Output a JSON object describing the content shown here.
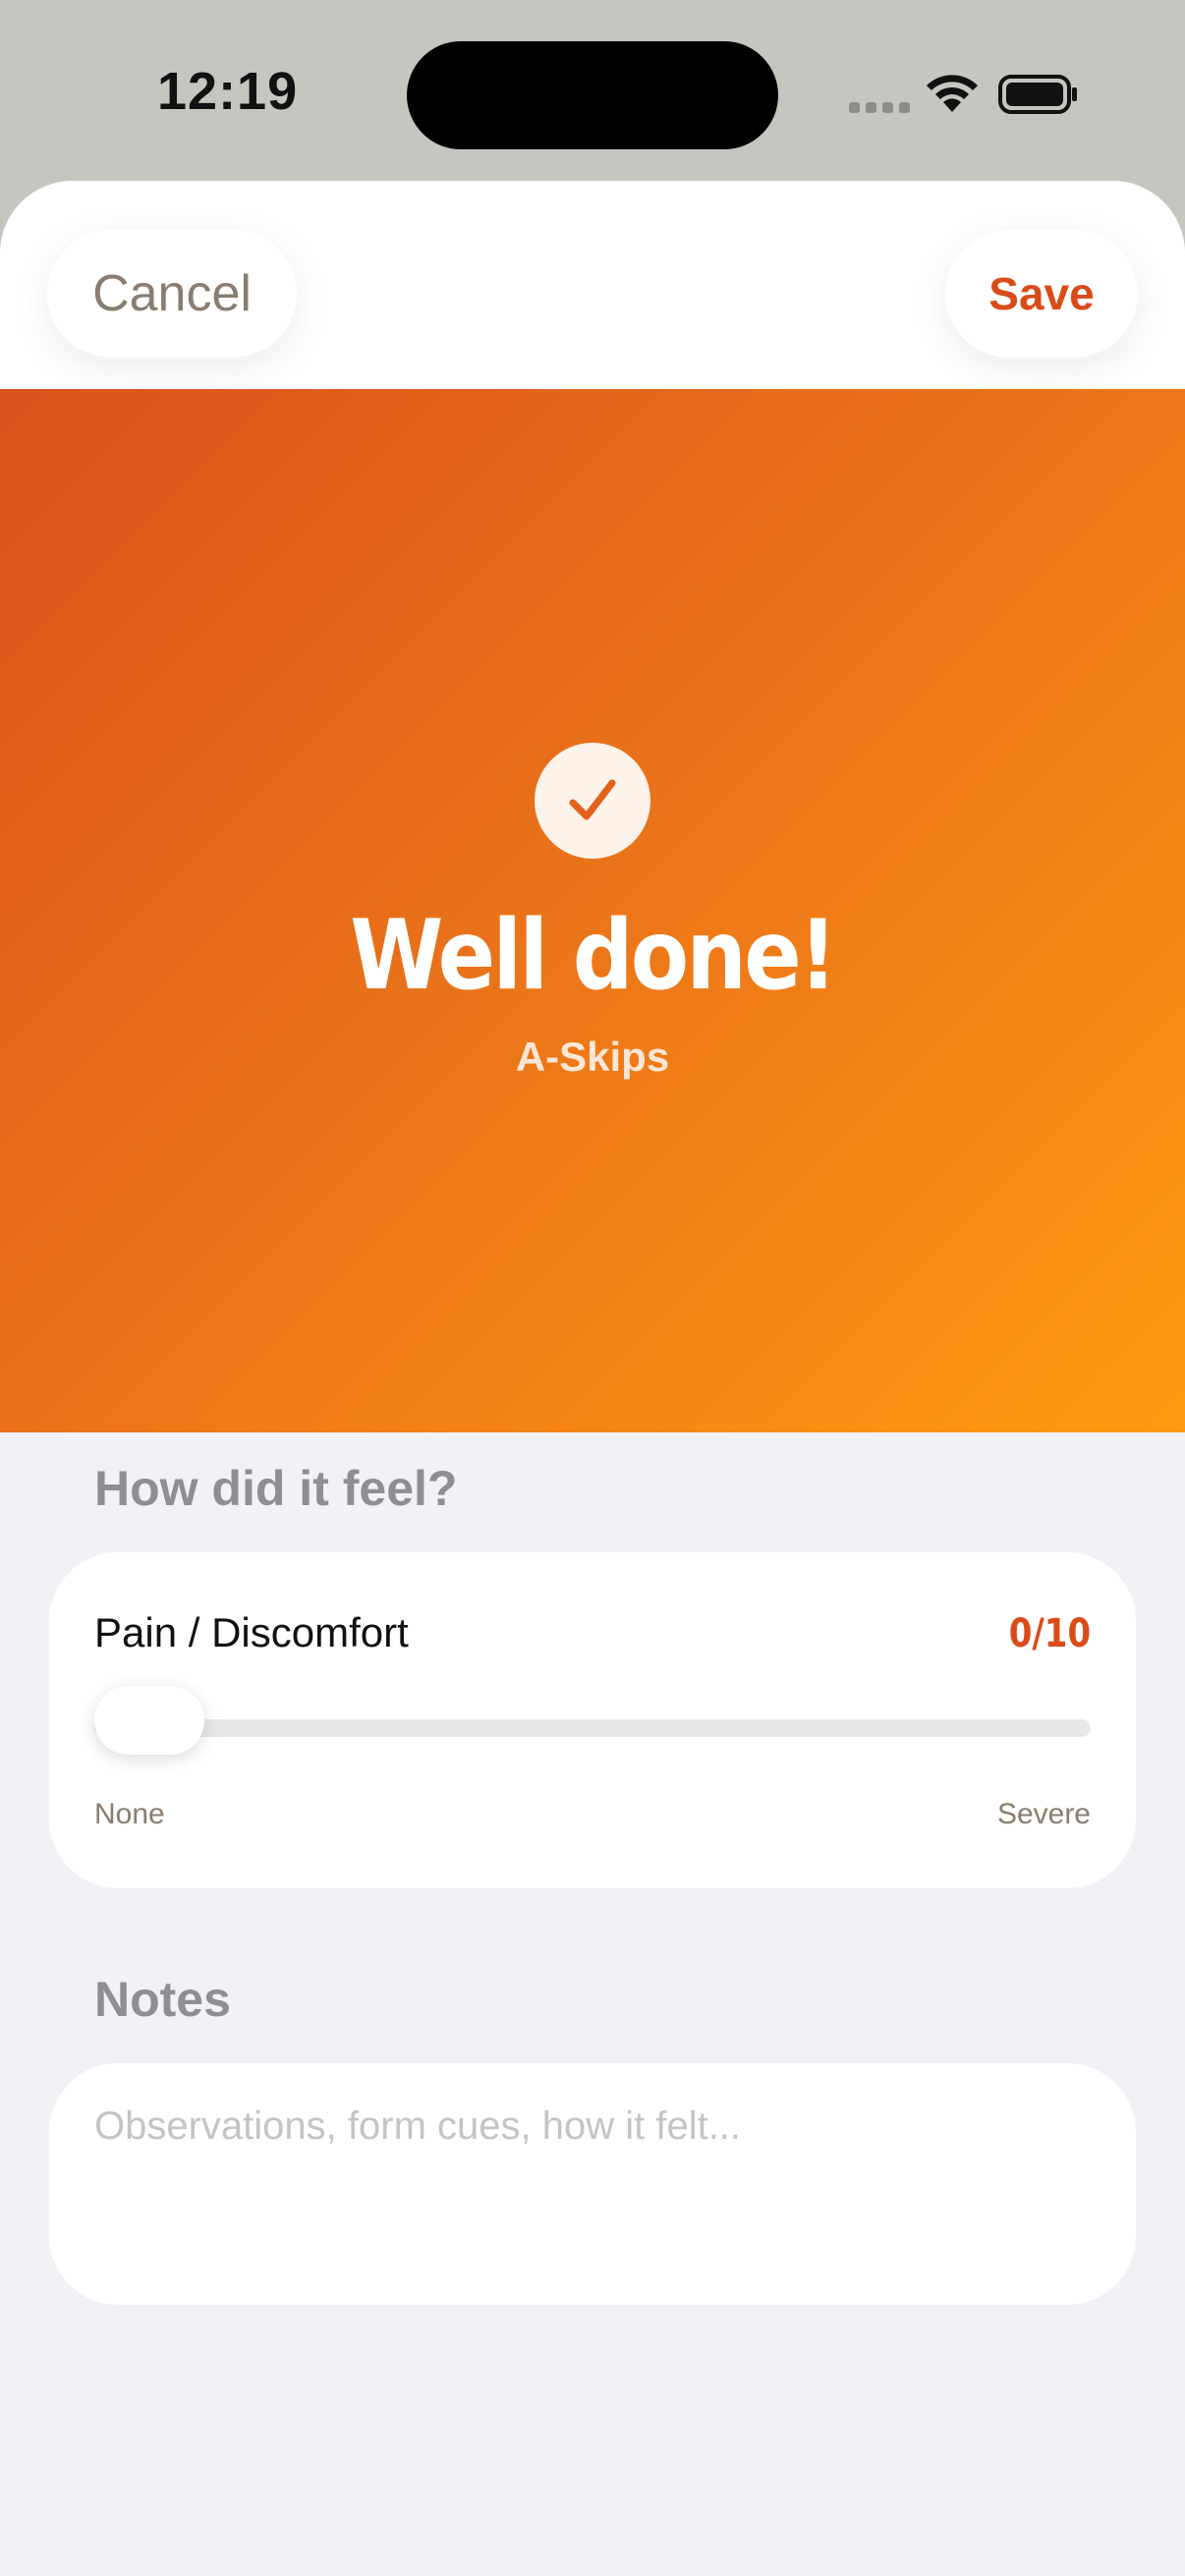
{
  "status_bar": {
    "time": "12:19"
  },
  "header": {
    "cancel_label": "Cancel",
    "save_label": "Save"
  },
  "hero": {
    "title": "Well done!",
    "subtitle": "A-Skips",
    "gradient_start": "#da521c",
    "gradient_end": "#ff9a12"
  },
  "feel_section": {
    "label": "How did it feel?",
    "pain": {
      "title": "Pain / Discomfort",
      "value_text": "0/10",
      "value": 0,
      "max": 10,
      "min_label": "None",
      "max_label": "Severe"
    }
  },
  "notes_section": {
    "label": "Notes",
    "placeholder": "Observations, form cues, how it felt...",
    "value": ""
  },
  "colors": {
    "accent": "#d94c1a",
    "secondary_text": "#8a7d6f",
    "section_label": "#8e8e93",
    "background": "#f2f2f6"
  },
  "icons": {
    "check": "checkmark-icon",
    "wifi": "wifi-icon",
    "battery": "battery-icon",
    "signal": "cellular-signal-icon"
  }
}
